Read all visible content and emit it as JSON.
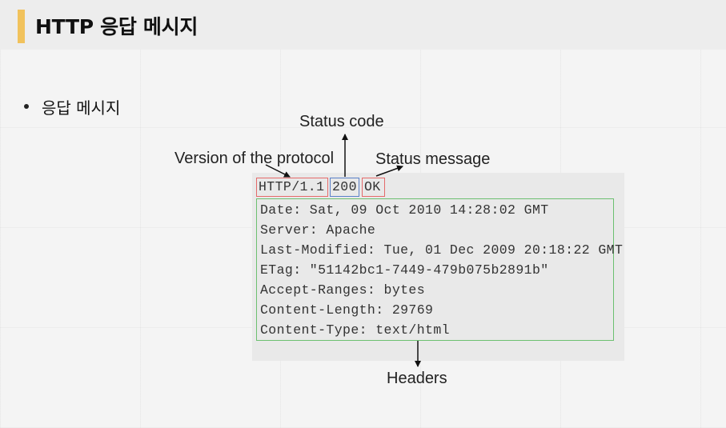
{
  "slide": {
    "title": "HTTP 응답 메시지",
    "bullet": "응답 메시지"
  },
  "diagram": {
    "labels": {
      "version": "Version of the protocol",
      "status_code": "Status code",
      "status_message": "Status message",
      "headers": "Headers"
    },
    "status_line": {
      "version": "HTTP/1.1",
      "code": "200",
      "message": "OK"
    },
    "headers": [
      "Date: Sat, 09 Oct 2010 14:28:02 GMT",
      "Server: Apache",
      "Last-Modified: Tue, 01 Dec 2009 20:18:22 GMT",
      "ETag: \"51142bc1-7449-479b075b2891b\"",
      "Accept-Ranges: bytes",
      "Content-Length: 29769",
      "Content-Type: text/html"
    ],
    "colors": {
      "version_box": "#e46a6a",
      "code_box": "#5a80c8",
      "message_box": "#e46a6a",
      "headers_box": "#6cc070",
      "accent": "#f1c25c"
    }
  }
}
